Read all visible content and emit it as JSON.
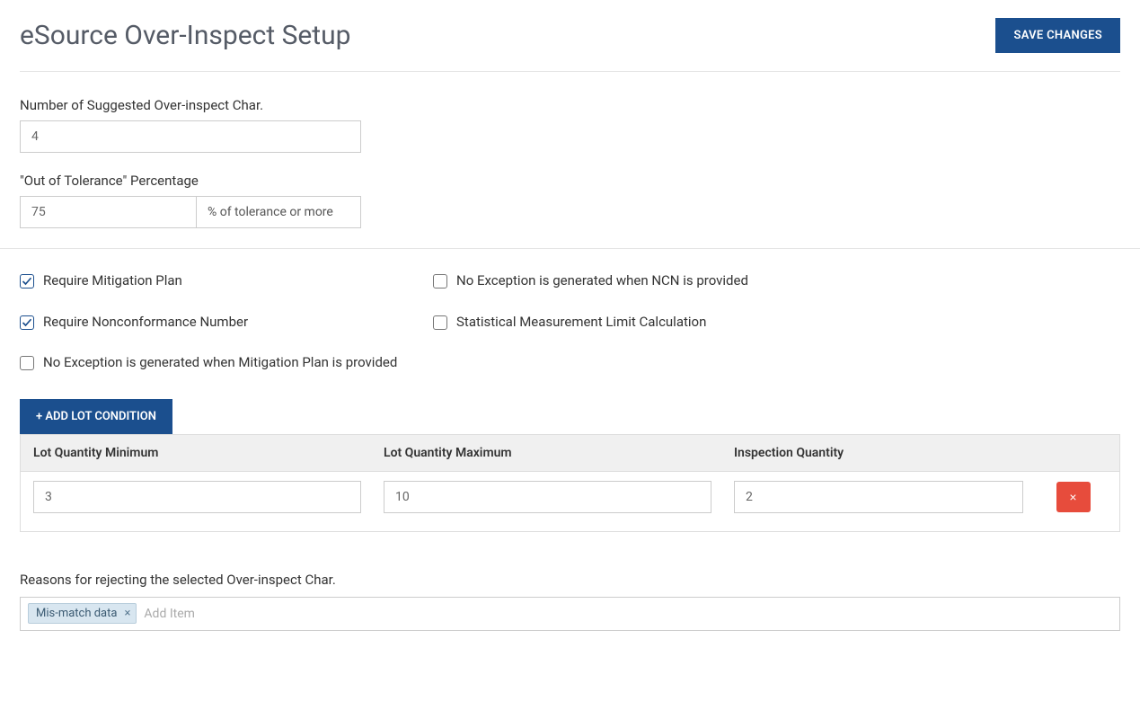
{
  "header": {
    "title": "eSource Over-Inspect Setup",
    "save_button": "SAVE CHANGES"
  },
  "form": {
    "suggested_char": {
      "label": "Number of Suggested Over-inspect Char.",
      "value": "4"
    },
    "out_of_tolerance": {
      "label": "\"Out of Tolerance\" Percentage",
      "value": "75",
      "suffix": "% of tolerance or more"
    }
  },
  "checkboxes": {
    "left": [
      {
        "label": "Require Mitigation Plan",
        "checked": true
      },
      {
        "label": "Require Nonconformance Number",
        "checked": true
      },
      {
        "label": "No Exception is generated when Mitigation Plan is provided",
        "checked": false
      }
    ],
    "right": [
      {
        "label": "No Exception is generated when NCN is provided",
        "checked": false
      },
      {
        "label": "Statistical Measurement Limit Calculation",
        "checked": false
      }
    ]
  },
  "lot": {
    "add_button": "+ ADD LOT CONDITION",
    "headers": {
      "min": "Lot Quantity Minimum",
      "max": "Lot Quantity Maximum",
      "inspection": "Inspection Quantity"
    },
    "rows": [
      {
        "min": "3",
        "max": "10",
        "inspection": "2"
      }
    ]
  },
  "reasons": {
    "label": "Reasons for rejecting the selected Over-inspect Char.",
    "tags": [
      "Mis-match data"
    ],
    "placeholder": "Add Item"
  }
}
